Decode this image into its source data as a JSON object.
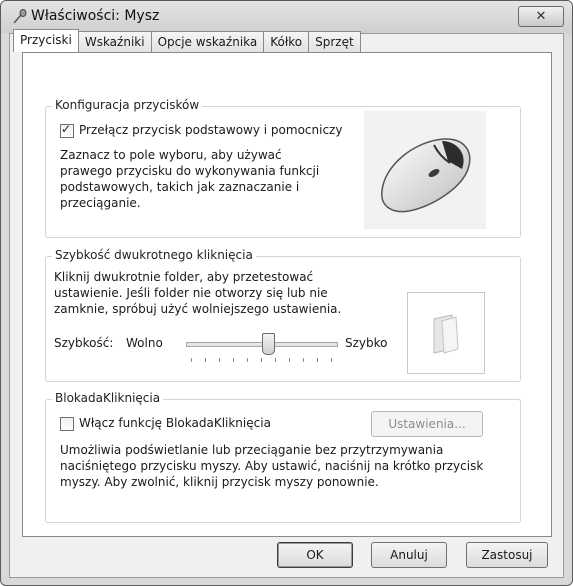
{
  "window": {
    "title": "Właściwości: Mysz",
    "close_label": "✕"
  },
  "tabs": [
    {
      "label": "Przyciski",
      "active": true
    },
    {
      "label": "Wskaźniki"
    },
    {
      "label": "Opcje wskaźnika"
    },
    {
      "label": "Kółko"
    },
    {
      "label": "Sprzęt"
    }
  ],
  "button_config": {
    "title": "Konfiguracja przycisków",
    "checkbox_label": "Przełącz przycisk podstawowy i pomocniczy",
    "checkbox_checked": true,
    "description": "Zaznacz to pole wyboru, aby używać prawego przycisku do wykonywania funkcji podstawowych, takich jak zaznaczanie i przeciąganie."
  },
  "double_click": {
    "title": "Szybkość dwukrotnego kliknięcia",
    "description": "Kliknij dwukrotnie folder, aby przetestować ustawienie. Jeśli folder nie otworzy się lub nie zamknie, spróbuj użyć wolniejszego ustawienia.",
    "speed_label": "Szybkość:",
    "slow_label": "Wolno",
    "fast_label": "Szybko",
    "slider_value": 0.55
  },
  "click_lock": {
    "title": "BlokadaKliknięcia",
    "checkbox_label": "Włącz funkcję BlokadaKliknięcia",
    "checkbox_checked": false,
    "settings_button": "Ustawienia...",
    "description": "Umożliwia podświetlanie lub przeciąganie bez przytrzymywania naciśniętego przycisku myszy. Aby ustawić, naciśnij na krótko przycisk myszy. Aby zwolnić, kliknij przycisk myszy ponownie."
  },
  "footer": {
    "ok": "OK",
    "cancel": "Anuluj",
    "apply": "Zastosuj"
  }
}
